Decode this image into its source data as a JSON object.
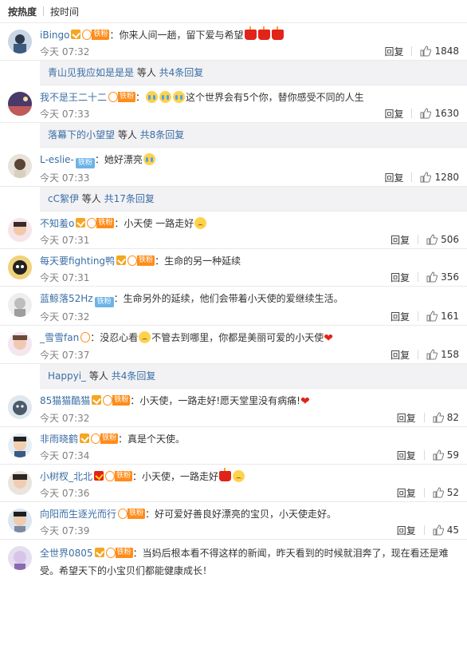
{
  "sort": {
    "hot": "按热度",
    "time": "按时间"
  },
  "labels": {
    "reply": "回复",
    "fan_small": "铁粉"
  },
  "comments": [
    {
      "id": "c1",
      "name": "iBingo",
      "sep": "：",
      "text": "你来人间一趟，留下爱与希望",
      "time": "今天 07:32",
      "likes": "1848",
      "sub": {
        "name": "青山见我应如是是是",
        "mid": " 等人 ",
        "more": "共4条回复"
      }
    },
    {
      "id": "c2",
      "name": "我不是王二十二",
      "sep": "：",
      "text": "这个世界会有5个你，替你感受不同的人生",
      "time": "今天 07:33",
      "likes": "1630",
      "sub": {
        "name": "落幕下的小望望",
        "mid": " 等人 ",
        "more": "共8条回复"
      }
    },
    {
      "id": "c3",
      "name": "L-eslie-",
      "sep": "：",
      "text": "她好漂亮",
      "time": "今天 07:33",
      "likes": "1280",
      "sub": {
        "name": "cC絮伊",
        "mid": " 等人 ",
        "more": "共17条回复"
      }
    },
    {
      "id": "c4",
      "name": "不知羞o",
      "sep": "：",
      "text": "小天使 一路走好",
      "time": "今天 07:31",
      "likes": "506"
    },
    {
      "id": "c5",
      "name": "每天要fighting鸭",
      "sep": "：",
      "text": "生命的另一种延续",
      "time": "今天 07:31",
      "likes": "356"
    },
    {
      "id": "c6",
      "name": "蓝鲸落52Hz",
      "sep": "：",
      "text": "生命另外的延续，他们会带着小天使的爱继续生活。",
      "time": "今天 07:32",
      "likes": "161"
    },
    {
      "id": "c7",
      "name": "_雪雪fan",
      "sep": "：",
      "text": "没忍心看",
      "text2": "不管去到哪里，你都是美丽可爱的小天使",
      "time": "今天 07:37",
      "likes": "158",
      "sub": {
        "name": "Happyi_",
        "mid": " 等人 ",
        "more": "共4条回复"
      }
    },
    {
      "id": "c8",
      "name": "85猫猫酷猫",
      "sep": "：",
      "text": "小天使，一路走好!愿天堂里没有病痛!",
      "time": "今天 07:32",
      "likes": "82"
    },
    {
      "id": "c9",
      "name": "非雨晓鹤",
      "sep": "：",
      "text": "真是个天使。",
      "time": "今天 07:34",
      "likes": "59"
    },
    {
      "id": "c10",
      "name": "小树杈_北北",
      "sep": "：",
      "text": "小天使，一路走好",
      "time": "今天 07:36",
      "likes": "52"
    },
    {
      "id": "c11",
      "name": "向阳而生逐光而行",
      "sep": "：",
      "text": "好可爱好善良好漂亮的宝贝，小天使走好。",
      "time": "今天 07:39",
      "likes": "45"
    },
    {
      "id": "c12",
      "name": "全世界0805",
      "sep": "：",
      "text": "当妈后根本看不得这样的新闻，昨天看到的时候就泪奔了，现在看还是难受。希望天下的小宝贝们都能健康成长！",
      "time": "",
      "likes": ""
    }
  ],
  "colors": {
    "link": "#3b6ea5",
    "time": "#808080",
    "subreply_bg": "#f2f2f5",
    "fan_orange": "#ff8c1a",
    "vip_gold": "#f5a623",
    "vip_red": "#e2231a"
  }
}
